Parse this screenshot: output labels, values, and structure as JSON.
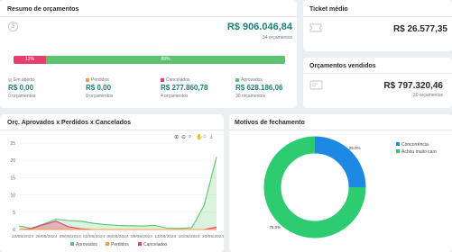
{
  "summary": {
    "title": "Resumo de orçamentos",
    "total_value": "R$ 906.046,84",
    "total_count": "34 orçamentos",
    "bar": {
      "red_label": "12%",
      "red_pct": 12,
      "green_label": "88%",
      "green_pct": 88
    },
    "stats": [
      {
        "label": "Em aberto",
        "value": "R$ 0,00",
        "count": "0 orçamentos",
        "color": "#cfd4d8"
      },
      {
        "label": "Perdidos",
        "value": "R$ 0,00",
        "count": "0 orçamentos",
        "color": "#f39c4a"
      },
      {
        "label": "Cancelados",
        "value": "R$ 277.860,78",
        "count": "4 orçamentos",
        "color": "#e83e6c"
      },
      {
        "label": "Aprovados",
        "value": "R$ 628.186,06",
        "count": "30 orçamentos",
        "color": "#5cc36f"
      }
    ]
  },
  "ticket": {
    "title": "Ticket médio",
    "value": "R$ 26.577,35"
  },
  "sold": {
    "title": "Orçamentos vendidos",
    "value": "R$ 797.320,46",
    "count": "30 orçamentos"
  },
  "line_chart": {
    "title": "Orç. Aprovados x Perdidos x Cancelados",
    "toolbar": [
      "⊕",
      "⊖",
      "⌕",
      "✋",
      "⌂",
      "⤓"
    ],
    "chart_data": {
      "type": "area",
      "x": [
        "22/05/2024",
        "26/05/2024",
        "29/05/2024",
        "02/06/2024",
        "06/06/2024",
        "09/06/2024",
        "13/06/2024",
        "16/06/2024",
        "20/06/2024"
      ],
      "yticks": [
        "25",
        "20",
        "15",
        "10",
        "5",
        "0"
      ],
      "ylim": [
        0,
        25
      ],
      "series": [
        {
          "name": "Aprovados",
          "color": "#5cc36f",
          "values": [
            1,
            0.4,
            1.6,
            3,
            2.6,
            2.4,
            1.8,
            1.4,
            1.2,
            1.1,
            1,
            1.2,
            0.4,
            0.3,
            0.5,
            7,
            21
          ]
        },
        {
          "name": "Perdidos",
          "color": "#f39c4a",
          "values": [
            0,
            0,
            0,
            0,
            0,
            0,
            0,
            0,
            0,
            0,
            0,
            0,
            0,
            0,
            0,
            0,
            0
          ]
        },
        {
          "name": "Cancelados",
          "color": "#e83e6c",
          "values": [
            0,
            0.2,
            1.4,
            2.4,
            0.8,
            0.2,
            0,
            0,
            0,
            0,
            0,
            0,
            0,
            0,
            0,
            0,
            0.7
          ]
        }
      ]
    }
  },
  "donut": {
    "title": "Motivos de fechamento",
    "chart_data": {
      "type": "pie",
      "slices": [
        {
          "name": "Concorrência",
          "value": 25.0,
          "label": "25.0%",
          "color": "#1e88e5"
        },
        {
          "name": "Achou muito caro",
          "value": 75.0,
          "label": "75.0%",
          "color": "#2ecc71"
        }
      ]
    }
  }
}
